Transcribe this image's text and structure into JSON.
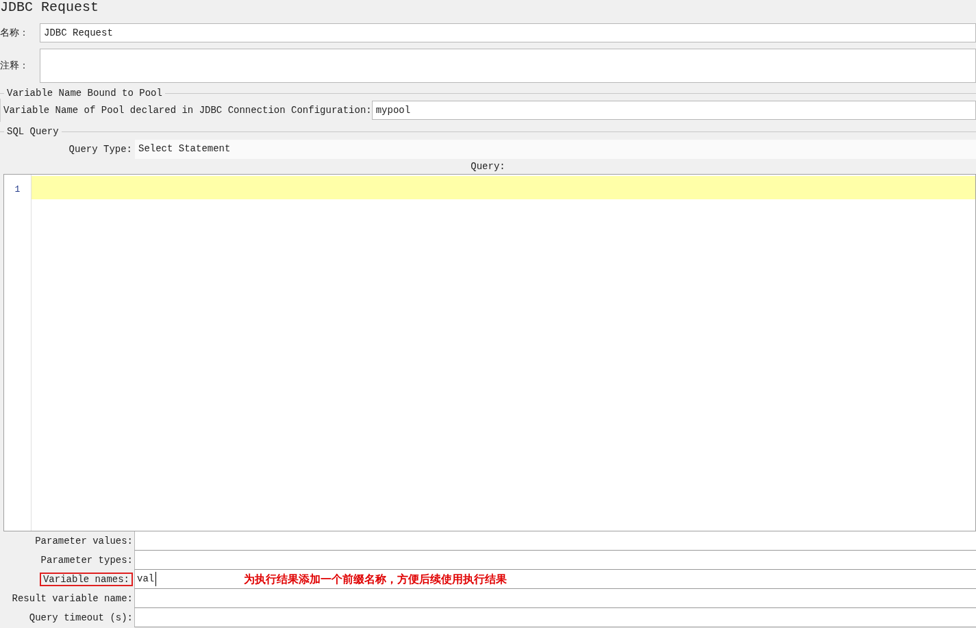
{
  "title": "JDBC Request",
  "name_field": {
    "label": "名称：",
    "value": "JDBC Request"
  },
  "comment_field": {
    "label": "注释："
  },
  "pool_section": {
    "legend": "Variable Name Bound to Pool",
    "label": "Variable Name of Pool declared in JDBC Connection Configuration:",
    "value": "mypool"
  },
  "sql_section": {
    "legend": "SQL Query",
    "query_type": {
      "label": "Query Type:",
      "value": "Select Statement"
    },
    "query_label": "Query:",
    "line_numbers": [
      "1"
    ]
  },
  "params": [
    {
      "label": "Parameter values:",
      "highlighted": false
    },
    {
      "label": "Parameter types:",
      "highlighted": false
    },
    {
      "label": "Variable names:",
      "value": "val",
      "highlighted": true,
      "annotation": "为执行结果添加一个前缀名称，方便后续使用执行结果"
    },
    {
      "label": "Result variable name:",
      "highlighted": false
    },
    {
      "label": "Query timeout (s):",
      "highlighted": false
    }
  ]
}
